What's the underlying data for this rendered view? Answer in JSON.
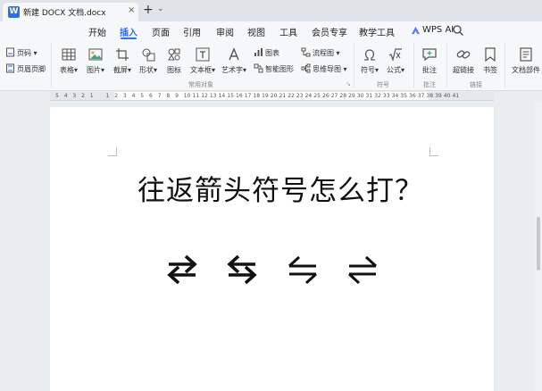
{
  "tab": {
    "title": "新建 DOCX 文档.docx",
    "close": "×",
    "plus": "+",
    "caret": "⌄"
  },
  "menu": {
    "items": [
      "开始",
      "插入",
      "页面",
      "引用",
      "审阅",
      "视图",
      "工具",
      "会员专享",
      "教学工具"
    ],
    "active": "插入",
    "wps_ai": "WPS AI"
  },
  "ribbon": {
    "page_number": "页码",
    "header_footer": "页眉页脚",
    "table": "表格",
    "picture": "图片",
    "screenshot": "截屏",
    "shape": "形状",
    "icon": "图标",
    "textbox": "文本框",
    "wordart": "艺术字",
    "chart": "图表",
    "flowchart": "流程图",
    "smartart": "智能图形",
    "mindmap": "思维导图",
    "symbol": "符号",
    "formula": "公式",
    "comment": "批注",
    "hyperlink": "超链接",
    "bookmark": "书签",
    "doc_parts": "文档部件",
    "groups": {
      "common_objects": "常用对象",
      "symbols": "符号",
      "comments": "批注",
      "links": "链接"
    }
  },
  "ruler": {
    "labels": [
      "5",
      "4",
      "3",
      "2",
      "1",
      "1",
      "2",
      "3",
      "4",
      "5",
      "6",
      "7",
      "8",
      "9",
      "10",
      "11",
      "12",
      "13",
      "14",
      "15",
      "16",
      "17",
      "18",
      "19",
      "20",
      "21",
      "22",
      "23",
      "24",
      "25",
      "26",
      "27",
      "28",
      "29",
      "30",
      "31",
      "32",
      "33",
      "34",
      "35",
      "36",
      "37",
      "38",
      "39",
      "40",
      "41"
    ]
  },
  "document": {
    "heading": "往返箭头符号怎么打？",
    "symbols": [
      "⇄",
      "⇆",
      "⇋",
      "⇌"
    ]
  },
  "colors": {
    "accent": "#2f6fe8",
    "page": "#ffffff",
    "canvas": "#e9ecf1"
  }
}
